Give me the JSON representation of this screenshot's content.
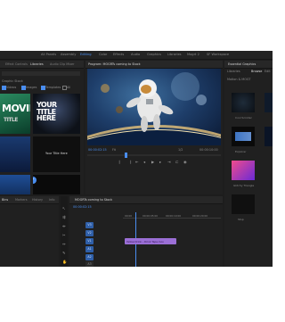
{
  "workspaces": [
    "All Panels",
    "Assembly",
    "Editing",
    "Color",
    "Effects",
    "Audio",
    "Graphics",
    "Libraries",
    "Mogrt 2",
    "SF Workspace"
  ],
  "workspace_active": 2,
  "left_tabs": [
    "Effect Controls",
    "Libraries",
    "Audio Clip Mixer"
  ],
  "left_tab_active": 1,
  "left_filter": {
    "label": "Graphic Stock",
    "checks": [
      "Videos",
      "Images",
      "Templates",
      "All"
    ]
  },
  "library_items": {
    "movie_title": "MOVIE",
    "movie_sub": "TITLE",
    "your_title": "YOUR TITLE HERE",
    "your_text": "Your Title Here"
  },
  "program": {
    "title": "Program: MOGRTs coming to Stock",
    "timecode_left": "00:00:02:15",
    "fit": "Fit",
    "fraction": "1/2",
    "timecode_right": "00:00:10:00"
  },
  "right_panel": {
    "title": "Essential Graphics",
    "tabs": [
      "Browse",
      "Edit"
    ],
    "lib_label": "Libraries",
    "sub_label": "Motion & MOGT",
    "items": [
      "Cool Scroller",
      "Clean Title",
      "Explorer",
      "Drive",
      "Glitchy Triangle",
      "Stop"
    ]
  },
  "project": {
    "tabs": [
      "Bins",
      "Markers",
      "History",
      "Info"
    ],
    "active": 0
  },
  "sequence": {
    "title": "MOGRTs coming to Stock",
    "timecode": "00:00:02:15",
    "clip_label": "Yellow Drink – Drink Tape.mov",
    "ruler": [
      "00:00",
      "00:00:05:00",
      "00:00:10:00",
      "00:00:15:00",
      "00:00:20:00"
    ]
  },
  "tracks": [
    "V3",
    "V2",
    "V1",
    "A1",
    "A2",
    "A3"
  ],
  "colors": {
    "accent": "#4a8ef0",
    "clip": "#9b6fd6",
    "bg": "#1d1d1d"
  }
}
